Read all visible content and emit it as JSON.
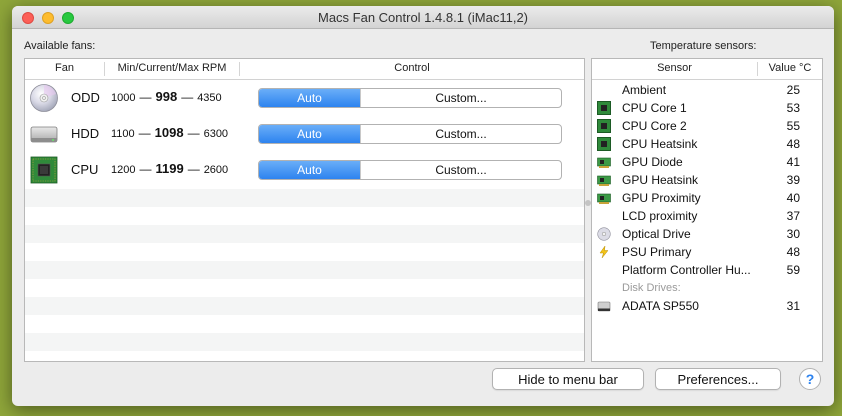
{
  "window": {
    "title": "Macs Fan Control 1.4.8.1 (iMac11,2)"
  },
  "fans_panel": {
    "label": "Available fans:",
    "headers": {
      "fan": "Fan",
      "rpm": "Min/Current/Max RPM",
      "control": "Control"
    },
    "fans": [
      {
        "name": "ODD",
        "icon": "optical-disc-icon",
        "min": "1000",
        "current": "998",
        "max": "4350",
        "mode_auto": "Auto",
        "mode_custom": "Custom...",
        "selected": "Auto"
      },
      {
        "name": "HDD",
        "icon": "hard-drive-icon",
        "min": "1100",
        "current": "1098",
        "max": "6300",
        "mode_auto": "Auto",
        "mode_custom": "Custom...",
        "selected": "Auto"
      },
      {
        "name": "CPU",
        "icon": "cpu-chip-icon",
        "min": "1200",
        "current": "1199",
        "max": "2600",
        "mode_auto": "Auto",
        "mode_custom": "Custom...",
        "selected": "Auto"
      }
    ],
    "dash": "—"
  },
  "sensors_panel": {
    "label": "Temperature sensors:",
    "headers": {
      "sensor": "Sensor",
      "value": "Value °C"
    },
    "sensors": [
      {
        "name": "Ambient",
        "value": "25",
        "icon": ""
      },
      {
        "name": "CPU Core 1",
        "value": "53",
        "icon": "cpu-chip-icon"
      },
      {
        "name": "CPU Core 2",
        "value": "55",
        "icon": "cpu-chip-icon"
      },
      {
        "name": "CPU Heatsink",
        "value": "48",
        "icon": "cpu-chip-icon"
      },
      {
        "name": "GPU Diode",
        "value": "41",
        "icon": "gpu-card-icon"
      },
      {
        "name": "GPU Heatsink",
        "value": "39",
        "icon": "gpu-card-icon"
      },
      {
        "name": "GPU Proximity",
        "value": "40",
        "icon": "gpu-card-icon"
      },
      {
        "name": "LCD proximity",
        "value": "37",
        "icon": ""
      },
      {
        "name": "Optical Drive",
        "value": "30",
        "icon": "optical-disc-icon"
      },
      {
        "name": "PSU Primary",
        "value": "48",
        "icon": "lightning-icon"
      },
      {
        "name": "Platform Controller Hu...",
        "value": "59",
        "icon": ""
      }
    ],
    "group_label": "Disk Drives:",
    "disks": [
      {
        "name": "ADATA SP550",
        "value": "31",
        "icon": "hard-drive-icon"
      }
    ]
  },
  "buttons": {
    "hide": "Hide to menu bar",
    "preferences": "Preferences...",
    "help": "?"
  },
  "colors": {
    "accent": "#2d83ef",
    "desktop": "#8fa63a"
  }
}
